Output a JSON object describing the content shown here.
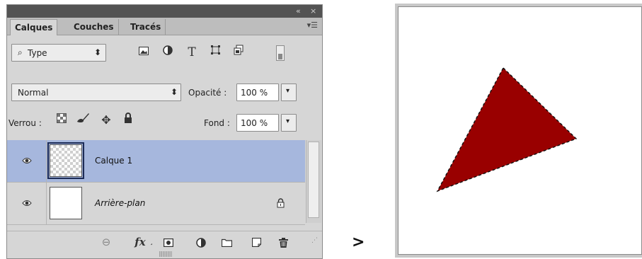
{
  "panel": {
    "titlebar": {
      "collapse_icon": "«",
      "close_icon": "×"
    },
    "tabs": [
      {
        "label": "Calques",
        "active": true
      },
      {
        "label": "Couches",
        "active": false
      },
      {
        "label": "Tracés",
        "active": false
      }
    ],
    "filter": {
      "search_icon": "⌕",
      "kind_label": "Type",
      "stepper_icon": "⬍"
    },
    "filter_icons": [
      "image-filter-icon",
      "adjustment-filter-icon",
      "type-filter-icon",
      "shape-filter-icon",
      "smart-object-filter-icon",
      "filter-toggle-icon"
    ],
    "blend": {
      "mode": "Normal",
      "opacity_label": "Opacité :",
      "opacity_value": "100 %"
    },
    "lock": {
      "label": "Verrou :",
      "fill_label": "Fond :",
      "fill_value": "100 %"
    },
    "layers": [
      {
        "name": "Calque 1",
        "selected": true,
        "visible": true,
        "thumbnail": "transparent"
      },
      {
        "name": "Arrière-plan",
        "selected": false,
        "visible": true,
        "locked": true,
        "thumbnail": "white"
      }
    ],
    "bottom_icons": [
      "link-layers-icon",
      "fx-icon",
      "add-mask-icon",
      "adjustment-layer-icon",
      "new-group-icon",
      "new-layer-icon",
      "delete-icon"
    ],
    "fx_label": "fx"
  },
  "separator": ">",
  "canvas": {
    "shape": "triangle",
    "fill": "#990000",
    "selection": "marching-ants"
  }
}
